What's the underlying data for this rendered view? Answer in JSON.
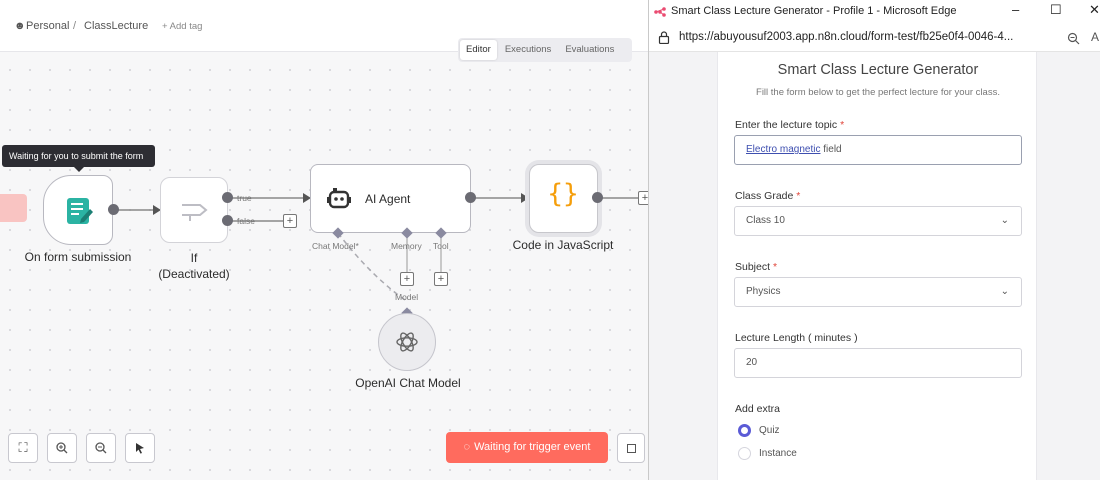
{
  "n8n": {
    "breadcrumb": {
      "project": "Personal",
      "separator": "/",
      "workflow": "ClassLecture",
      "add_tag": "+ Add tag"
    },
    "tabs": [
      "Editor",
      "Executions",
      "Evaluations"
    ],
    "active_tab": "Editor",
    "tooltip": "Waiting for you to submit the form",
    "nodes": {
      "form_trigger": {
        "label": "On form submission"
      },
      "if_node": {
        "label_line1": "If",
        "label_line2": "(Deactivated)",
        "true_label": "true",
        "false_label": "false"
      },
      "ai_agent": {
        "label": "AI Agent",
        "ports": [
          "Chat Model*",
          "Memory",
          "Tool"
        ]
      },
      "code": {
        "label": "Code in JavaScript",
        "glyph": "{}"
      },
      "openai": {
        "label": "OpenAI Chat Model",
        "port": "Model"
      }
    },
    "trigger_button": "Waiting for trigger event",
    "colors": {
      "accent": "#ff6b5e",
      "code_orange": "#f59e0b",
      "form_teal": "#2bb3a3"
    }
  },
  "edge": {
    "title": "Smart Class Lecture Generator - Profile 1 - Microsoft Edge",
    "url": "https://abuyousuf2003.app.n8n.cloud/form-test/fb25e0f4-0046-4...",
    "window_buttons": [
      "–",
      "☐",
      "✕"
    ]
  },
  "form": {
    "title": "Smart Class Lecture Generator",
    "subtitle": "Fill the form below to get the perfect lecture for your class.",
    "fields": {
      "topic": {
        "label": "Enter the lecture topic",
        "required": "*",
        "value_underlined": "Electro magnetic",
        "value_rest": " field"
      },
      "grade": {
        "label": "Class Grade",
        "required": "*",
        "value": "Class 10"
      },
      "subject": {
        "label": "Subject",
        "required": "*",
        "value": "Physics"
      },
      "length": {
        "label": "Lecture Length ( minutes )",
        "value": "20"
      },
      "extra": {
        "label": "Add extra",
        "options": [
          {
            "label": "Quiz",
            "selected": true
          },
          {
            "label": "Instance",
            "selected": false
          }
        ]
      }
    }
  }
}
